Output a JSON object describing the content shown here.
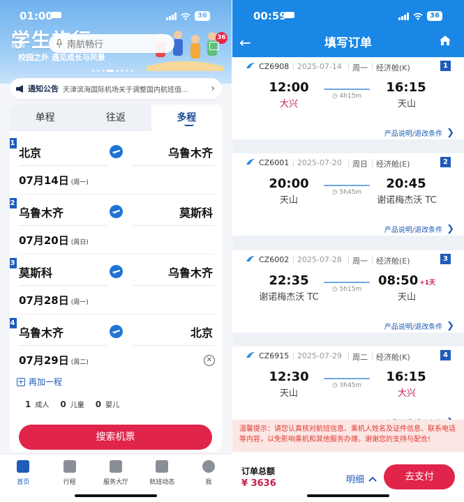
{
  "left": {
    "status": {
      "time": "01:00",
      "battery": "36"
    },
    "banner": {
      "title": "学生旅行",
      "subtitle": "校园之外 遇见成长与风景",
      "city": "珠海",
      "search_placeholder": "南航畅行",
      "badge": "36"
    },
    "notice": {
      "label": "通知公告",
      "text": "天津滨海国际机场关于调整国内航班值..."
    },
    "tabs": [
      {
        "label": "单程"
      },
      {
        "label": "往返"
      },
      {
        "label": "多程"
      }
    ],
    "segments": [
      {
        "num": "1",
        "from": "北京",
        "to": "乌鲁木齐",
        "date": "07月14日",
        "weekday": "(周一)"
      },
      {
        "num": "2",
        "from": "乌鲁木齐",
        "to": "莫斯科",
        "date": "07月20日",
        "weekday": "(周日)"
      },
      {
        "num": "3",
        "from": "莫斯科",
        "to": "乌鲁木齐",
        "date": "07月28日",
        "weekday": "(周一)"
      },
      {
        "num": "4",
        "from": "乌鲁木齐",
        "to": "北京",
        "date": "07月29日",
        "weekday": "(周二)"
      }
    ],
    "add_segment": "再加一程",
    "passengers": [
      {
        "count": "1",
        "label": "成人"
      },
      {
        "count": "0",
        "label": "儿童"
      },
      {
        "count": "0",
        "label": "婴儿"
      }
    ],
    "search_button": "搜索机票",
    "tabbar": [
      {
        "label": "首页"
      },
      {
        "label": "行程"
      },
      {
        "label": "服务大厅"
      },
      {
        "label": "航班动态"
      },
      {
        "label": "我"
      }
    ]
  },
  "right": {
    "status": {
      "time": "00:59",
      "battery": "36"
    },
    "title": "填写订单",
    "flights": [
      {
        "num": "1",
        "code": "CZ6908",
        "date": "2025-07-14",
        "weekday": "周一",
        "cabin": "经济舱(K)",
        "dep_time": "12:00",
        "dep_airport": "大兴",
        "duration": "4h15m",
        "arr_time": "16:15",
        "arr_airport": "天山",
        "plus_day": "",
        "condition": "产品说明/退改条件"
      },
      {
        "num": "2",
        "code": "CZ6001",
        "date": "2025-07-20",
        "weekday": "周日",
        "cabin": "经济舱(E)",
        "dep_time": "20:00",
        "dep_airport": "天山",
        "duration": "5h45m",
        "arr_time": "20:45",
        "arr_airport": "谢诺梅杰沃 TC",
        "plus_day": "",
        "condition": "产品说明/退改条件"
      },
      {
        "num": "3",
        "code": "CZ6002",
        "date": "2025-07-28",
        "weekday": "周一",
        "cabin": "经济舱(E)",
        "dep_time": "22:35",
        "dep_airport": "谢诺梅杰沃 TC",
        "duration": "5h15m",
        "arr_time": "08:50",
        "arr_airport": "天山",
        "plus_day": "+1天",
        "condition": "产品说明/退改条件"
      },
      {
        "num": "4",
        "code": "CZ6915",
        "date": "2025-07-29",
        "weekday": "周二",
        "cabin": "经济舱(K)",
        "dep_time": "12:30",
        "dep_airport": "天山",
        "duration": "3h45m",
        "arr_time": "16:15",
        "arr_airport": "大兴",
        "plus_day": "",
        "condition": "产品说明/退改条件"
      }
    ],
    "tip": "温馨提示：请您认真核对航班信息、乘机人姓名及证件信息、联系电话等内容，以免影响乘机和其他服务办理。谢谢您的支持与配合!",
    "total_label": "订单总额",
    "total_value": "¥ 3636",
    "detail_label": "明细",
    "pay_button": "去支付"
  },
  "colors": {
    "brand_blue": "#1a86e6",
    "accent_red": "#e0244a",
    "price_red": "#c41f4a",
    "link_blue": "#1e5cb8"
  }
}
